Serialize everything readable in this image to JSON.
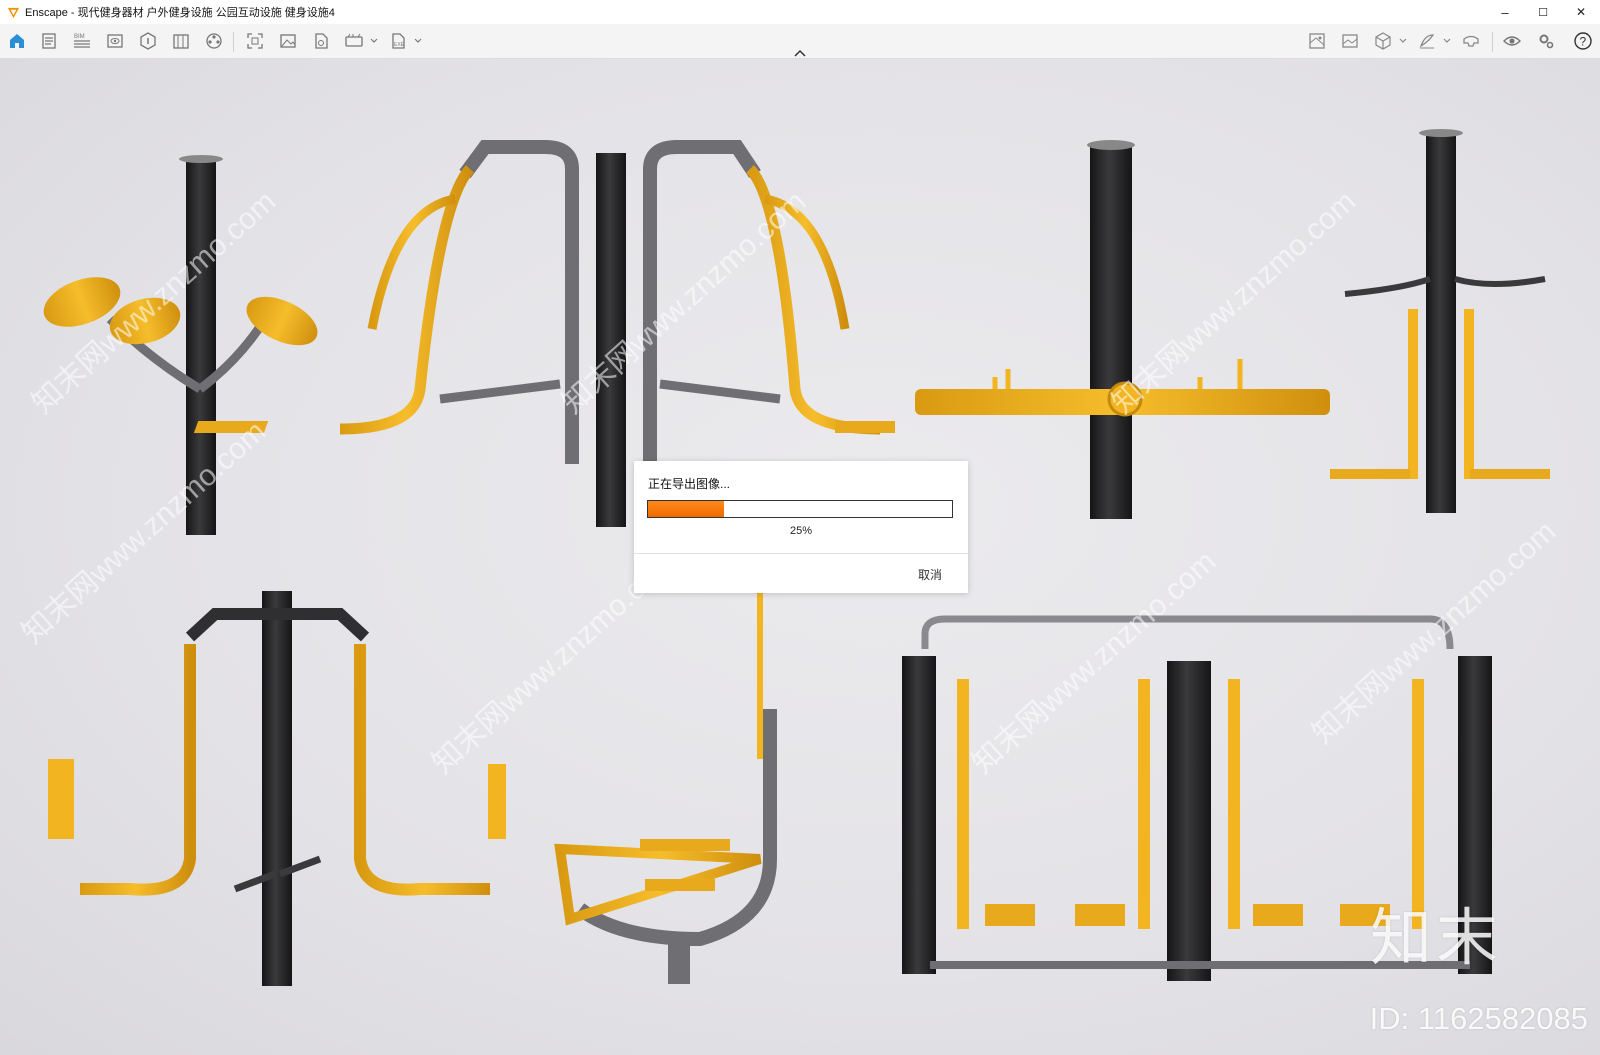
{
  "window": {
    "title": "Enscape - 现代健身器材 户外健身设施 公园互动设施 健身设施4",
    "controls": {
      "minimize": "–",
      "maximize": "☐",
      "close": "✕"
    }
  },
  "toolbar": {
    "accent_color": "#2a8fd6",
    "left_icons": [
      "home-icon",
      "document-icon",
      "bim-icon",
      "view-icon",
      "asset-icon",
      "library-icon",
      "settings-film-icon",
      "screenshot-icon",
      "image-icon",
      "batch-render-icon",
      "panorama-icon",
      "export-icon"
    ],
    "right_icons": [
      "map-icon",
      "gallery-icon",
      "cube-icon",
      "draw-icon",
      "vr-icon",
      "visibility-icon",
      "settings-icon",
      "help-icon"
    ],
    "bim_label": "BIM",
    "exe_label": "EXE",
    "help_label": "?"
  },
  "dialog": {
    "title": "正在导出图像...",
    "progress": 0.25,
    "progress_text": "25%",
    "cancel_label": "取消",
    "progress_color": "#f57a0c"
  },
  "viewport": {
    "watermark_brand": "知末",
    "watermark_id": "ID: 1162582085",
    "diagonal_watermark": "知末网www.znzmo.com",
    "colors": {
      "yellow": "#f2b521",
      "dark": "#2a2a2c",
      "gray": "#6f6f73"
    }
  }
}
